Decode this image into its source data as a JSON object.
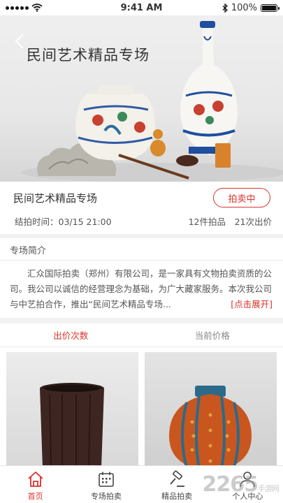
{
  "status": {
    "time": "9:41 AM",
    "battery": "100%",
    "battery_level": 1.0
  },
  "banner": {
    "title": "民间艺术精品专场"
  },
  "session": {
    "title": "民间艺术精品专场",
    "status_badge": "拍卖中",
    "end_time": "结拍时间：03/15 21:00",
    "lot_count": "12件拍品",
    "bid_count": "21次出价"
  },
  "intro": {
    "heading": "专场简介",
    "text": "汇众国际拍卖（郑州）有限公司，是一家具有文物拍卖资质的公司。我公司以诚信的经营理念为基础，为广大藏家服务。本次我公司与中艺拍合作，推出“民间艺术精品专场...",
    "expand": "[点击展开]"
  },
  "sort_tabs": [
    {
      "label": "出价次数",
      "active": true
    },
    {
      "label": "当前价格",
      "active": false
    }
  ],
  "tabbar": [
    {
      "label": "首页",
      "icon": "home-icon",
      "active": true
    },
    {
      "label": "专场拍卖",
      "icon": "calendar-icon",
      "active": false
    },
    {
      "label": "精品拍卖",
      "icon": "gavel-icon",
      "active": false
    },
    {
      "label": "个人中心",
      "icon": "person-icon",
      "active": false
    }
  ],
  "watermark": {
    "brand": "2265",
    "suffix": "手游网"
  },
  "colors": {
    "accent": "#d9332b"
  }
}
